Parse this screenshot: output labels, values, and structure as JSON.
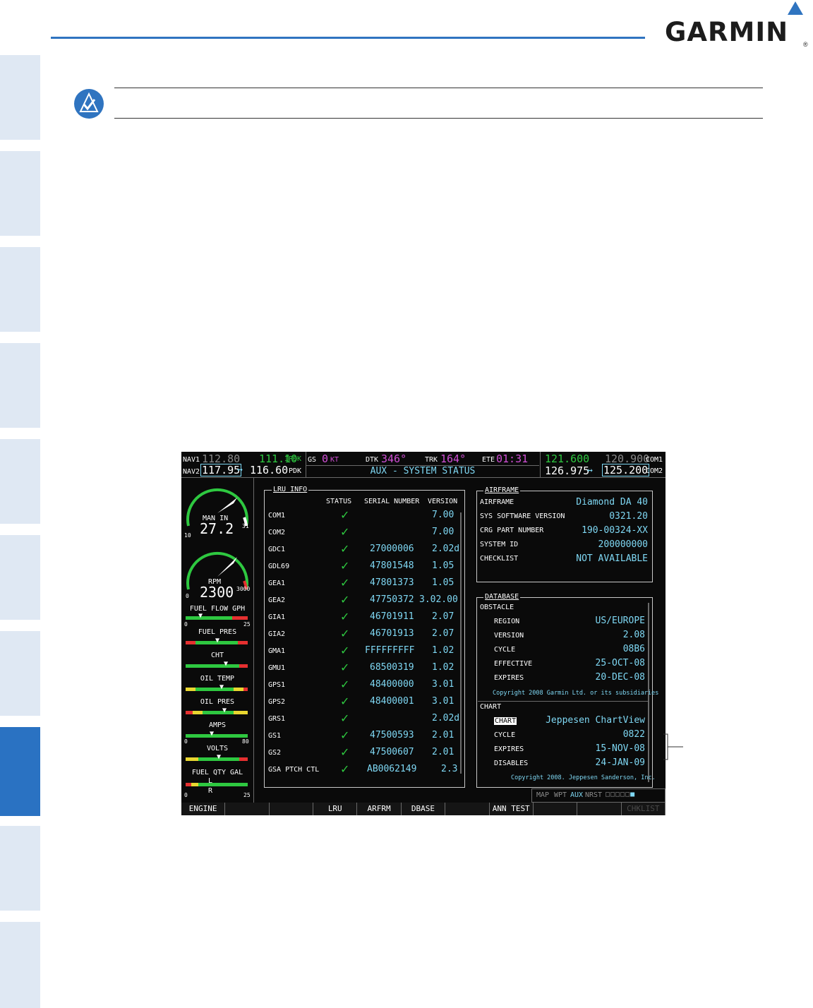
{
  "logo": {
    "text": "GARMIN",
    "reg": "®"
  },
  "mfd": {
    "top": {
      "nav1_label": "NAV1",
      "nav1_standby": "112.80",
      "nav1_active": "111.10",
      "nav1_id": "IPDK",
      "nav2_label": "NAV2",
      "nav2_active": "117.95",
      "nav2_swap": "↔",
      "nav2_standby": "116.60",
      "nav2_id": "PDK",
      "gs_label": "GS",
      "gs_value": "0",
      "gs_unit": "KT",
      "dtk_label": "DTK",
      "dtk_value": "346°",
      "trk_label": "TRK",
      "trk_value": "164°",
      "ete_label": "ETE",
      "ete_value": "01:31",
      "page_title": "AUX - SYSTEM STATUS",
      "com1_active": "121.600",
      "com1_standby": "120.900",
      "com1_label": "COM1",
      "com2_active": "126.975",
      "com2_swap": "↔",
      "com2_standby": "125.200",
      "com2_label": "COM2"
    },
    "eis": {
      "man_in_label": "MAN IN",
      "man_in_value": "27.2",
      "man_in_min": "10",
      "man_in_max": "31",
      "rpm_label": "RPM",
      "rpm_value": "2300",
      "rpm_min": "0",
      "rpm_max": "3000",
      "fuel_flow_label": "FUEL FLOW GPH",
      "fuel_flow_min": "0",
      "fuel_flow_max": "25",
      "fuel_pres_label": "FUEL PRES",
      "cht_label": "CHT",
      "oil_temp_label": "OIL TEMP",
      "oil_pres_label": "OIL PRES",
      "amps_label": "AMPS",
      "amps_min": "0",
      "amps_max": "80",
      "volts_label": "VOLTS",
      "fuel_qty_label": "FUEL QTY GAL",
      "fuel_qty_min": "0",
      "fuel_qty_max": "25",
      "fuel_qty_l": "L",
      "fuel_qty_r": "R"
    },
    "lru": {
      "title": "LRU INFO",
      "headers": {
        "status": "STATUS",
        "serial": "SERIAL NUMBER",
        "version": "VERSION"
      },
      "rows": [
        {
          "name": "COM1",
          "serial": "",
          "version": "7.00"
        },
        {
          "name": "COM2",
          "serial": "",
          "version": "7.00"
        },
        {
          "name": "GDC1",
          "serial": "27000006",
          "version": "2.02d"
        },
        {
          "name": "GDL69",
          "serial": "47801548",
          "version": "1.05"
        },
        {
          "name": "GEA1",
          "serial": "47801373",
          "version": "1.05"
        },
        {
          "name": "GEA2",
          "serial": "47750372",
          "version": "3.02.00"
        },
        {
          "name": "GIA1",
          "serial": "46701911",
          "version": "2.07"
        },
        {
          "name": "GIA2",
          "serial": "46701913",
          "version": "2.07"
        },
        {
          "name": "GMA1",
          "serial": "FFFFFFFFF",
          "version": "1.02"
        },
        {
          "name": "GMU1",
          "serial": "68500319",
          "version": "1.02"
        },
        {
          "name": "GPS1",
          "serial": "48400000",
          "version": "3.01"
        },
        {
          "name": "GPS2",
          "serial": "48400001",
          "version": "3.01"
        },
        {
          "name": "GRS1",
          "serial": "",
          "version": "2.02d"
        },
        {
          "name": "GS1",
          "serial": "47500593",
          "version": "2.01"
        },
        {
          "name": "GS2",
          "serial": "47500607",
          "version": "2.01"
        },
        {
          "name": "GSA PTCH CTL",
          "serial": "AB0062149",
          "version": "2.3"
        }
      ]
    },
    "airframe": {
      "title": "AIRFRAME",
      "rows": [
        {
          "label": "AIRFRAME",
          "value": "Diamond DA 40"
        },
        {
          "label": "SYS SOFTWARE VERSION",
          "value": "0321.20"
        },
        {
          "label": "CRG PART NUMBER",
          "value": "190-00324-XX"
        },
        {
          "label": "SYSTEM ID",
          "value": "200000000"
        },
        {
          "label": "CHECKLIST",
          "value": "NOT AVAILABLE"
        }
      ]
    },
    "database": {
      "title": "DATABASE",
      "obstacle_title": "OBSTACLE",
      "obstacle_rows": [
        {
          "label": "REGION",
          "value": "US/EUROPE"
        },
        {
          "label": "VERSION",
          "value": "2.08"
        },
        {
          "label": "CYCLE",
          "value": "08B6"
        },
        {
          "label": "EFFECTIVE",
          "value": "25-OCT-08"
        },
        {
          "label": "EXPIRES",
          "value": "20-DEC-08"
        }
      ],
      "obstacle_copyright": "Copyright 2008 Garmin Ltd. or its subsidiaries",
      "chart_title": "CHART",
      "chart_name_label": "CHART",
      "chart_name_value": "Jeppesen ChartView",
      "chart_rows": [
        {
          "label": "CYCLE",
          "value": "0822"
        },
        {
          "label": "EXPIRES",
          "value": "15-NOV-08"
        },
        {
          "label": "DISABLES",
          "value": "24-JAN-09"
        }
      ],
      "chart_copyright": "Copyright 2008. Jeppesen Sanderson, Inc."
    },
    "page_group": {
      "map": "MAP",
      "wpt": "WPT",
      "aux": "AUX",
      "nrst": "NRST"
    },
    "softkeys": [
      "ENGINE",
      "",
      "",
      "LRU",
      "ARFRM",
      "DBASE",
      "",
      "ANN TEST",
      "",
      "",
      "CHKLIST"
    ]
  }
}
